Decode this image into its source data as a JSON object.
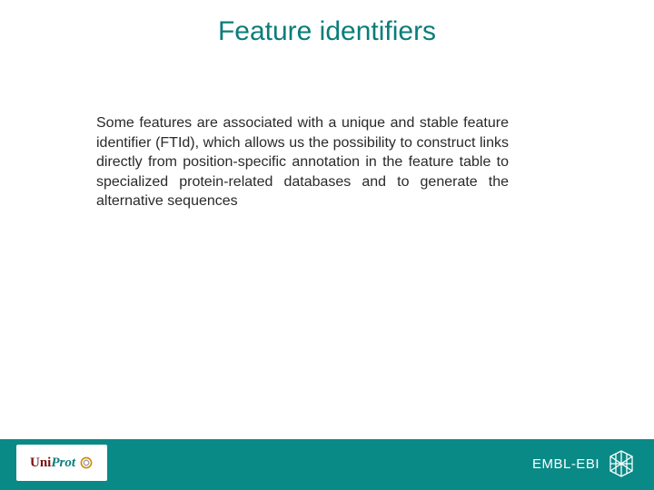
{
  "title": "Feature identifiers",
  "body": "Some features are associated with a unique and stable feature identifier (FTId), which allows us the possibility to construct links directly from position-specific annotation in the feature table to specialized protein-related databases and to generate the alternative sequences",
  "footer": {
    "uniprot": {
      "uni": "Uni",
      "prot": "Prot"
    },
    "ebi": "EMBL-EBI"
  },
  "colors": {
    "accent": "#0a7d7a",
    "footer_bg": "#0a8a87",
    "uni": "#7a1212"
  }
}
